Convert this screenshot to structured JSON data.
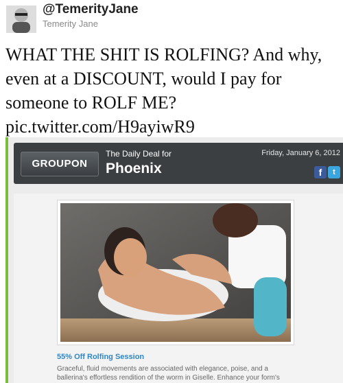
{
  "tweet": {
    "handle": "@TemerityJane",
    "display_name": "Temerity Jane",
    "text": "WHAT THE SHIT IS ROLFING? And why, even at a DISCOUNT, would I pay for someone to ROLF ME?",
    "link": "pic.twitter.com/H9ayiwR9"
  },
  "groupon": {
    "logo": "GROUPON",
    "kicker": "The Daily Deal for",
    "city": "Phoenix",
    "date": "Friday, January 6, 2012",
    "social_icons": [
      "facebook-icon",
      "twitter-icon"
    ],
    "deal_title": "55% Off Rolfing Session",
    "deal_description": "Graceful, fluid movements are associated with elegance, poise, and a ballerina's effortless rendition of the worm in Giselle. Enhance your form's"
  },
  "colors": {
    "accent_green": "#79bd3f",
    "header_dark": "#3b3f42",
    "deal_link_blue": "#2f86c7"
  }
}
